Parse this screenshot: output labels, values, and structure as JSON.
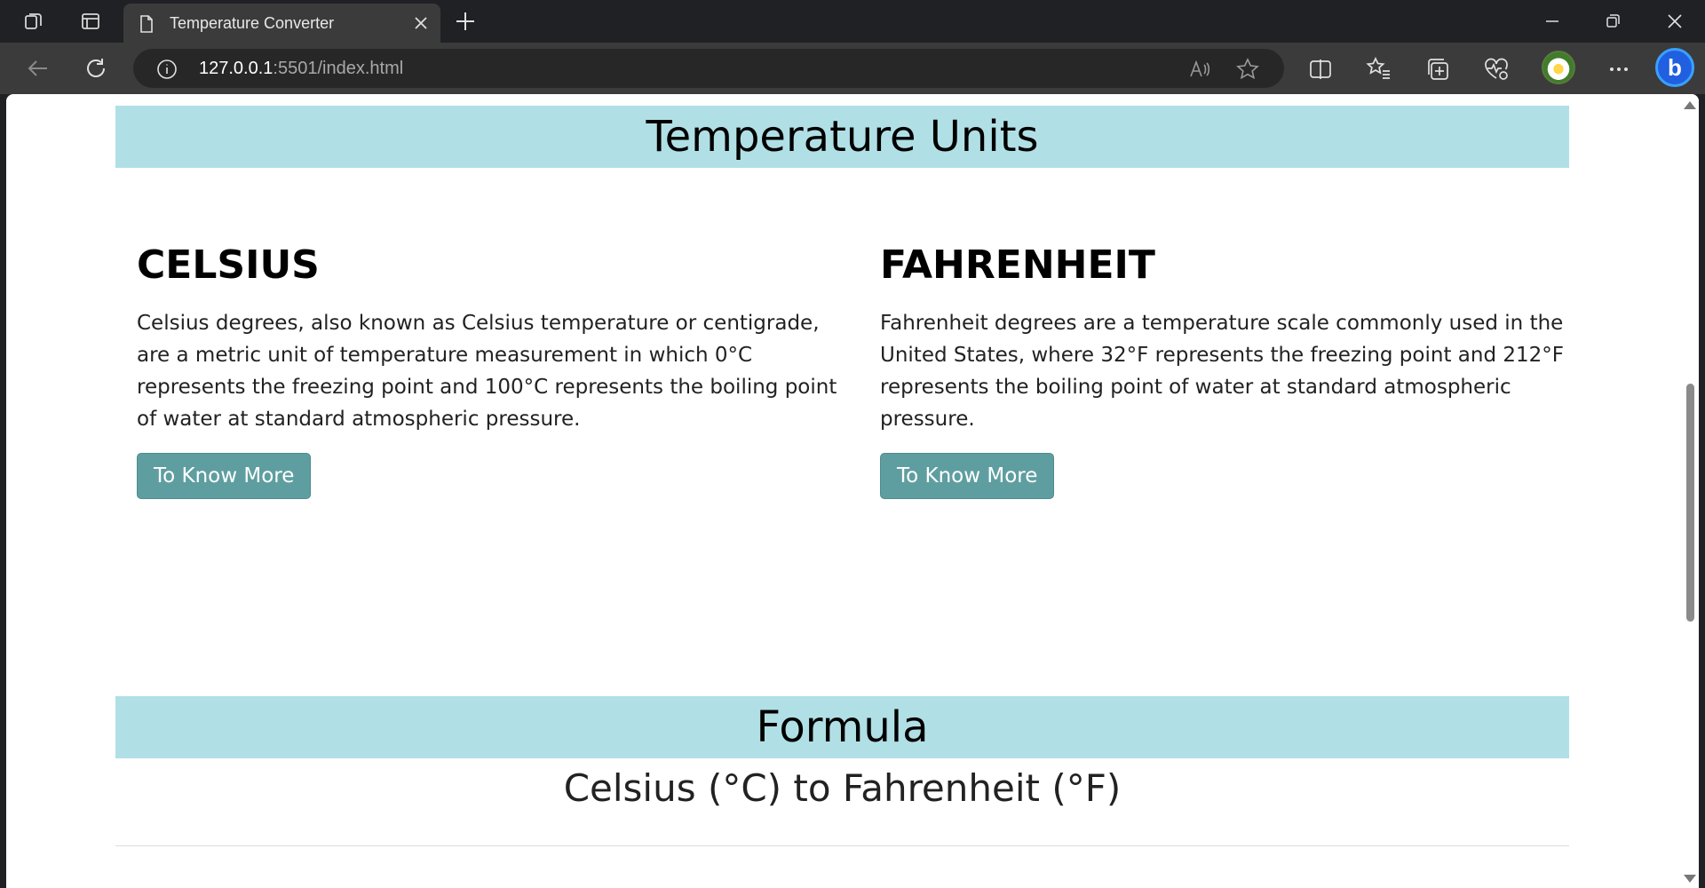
{
  "browser": {
    "tab_title": "Temperature Converter",
    "url_host": "127.0.0.1",
    "url_rest": ":5501/index.html"
  },
  "icons": {
    "workspaces": "workspaces-icon",
    "tab_actions": "tab-actions-icon",
    "doc": "document-icon",
    "close": "close-icon",
    "new_tab": "plus-icon",
    "back": "back-arrow-icon",
    "refresh": "refresh-icon",
    "info": "info-icon",
    "read_aloud": "read-aloud-icon",
    "favorite": "star-icon",
    "split": "split-screen-icon",
    "favorites": "favorites-icon",
    "collections": "collections-icon",
    "health": "browser-essentials-icon",
    "more": "more-icon",
    "bing": "bing-icon"
  },
  "colors": {
    "band": "#b0e0e6",
    "button": "#5f9ea0"
  },
  "page": {
    "units_heading": "Temperature Units",
    "celsius": {
      "title": "CELSIUS",
      "text": "Celsius degrees, also known as Celsius temperature or centigrade, are a metric unit of temperature measurement in which 0°C represents the freezing point and 100°C represents the boiling point of water at standard atmospheric pressure.",
      "button": "To Know More"
    },
    "fahrenheit": {
      "title": "FAHRENHEIT",
      "text": "Fahrenheit degrees are a temperature scale commonly used in the United States, where 32°F represents the freezing point and 212°F represents the boiling point of water at standard atmospheric pressure.",
      "button": "To Know More"
    },
    "formula_heading": "Formula",
    "formula_sub": "Celsius (°C) to Fahrenheit (°F)"
  }
}
